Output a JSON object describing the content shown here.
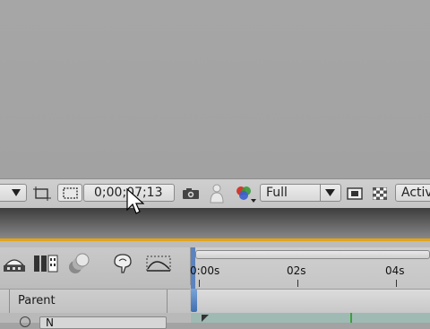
{
  "comp_toolbar": {
    "timecode": "0;00;07;13",
    "resolution": "Full",
    "view_label": "Activ",
    "icons": [
      "dropdown-arrow-icon",
      "region-of-interest-icon",
      "transparency-grid-icon",
      "snapshot-camera-icon",
      "show-snapshot-icon",
      "color-channels-icon",
      "dropdown-arrow-icon",
      "fast-previews-icon",
      "checkerboard-icon"
    ]
  },
  "timeline": {
    "ruler_labels": [
      "0:00s",
      "02s",
      "04s"
    ],
    "columns": {
      "parent": "Parent"
    },
    "layer_first_value": "N",
    "accent_color": "#e4a318",
    "track_color": "#9fbab3"
  }
}
